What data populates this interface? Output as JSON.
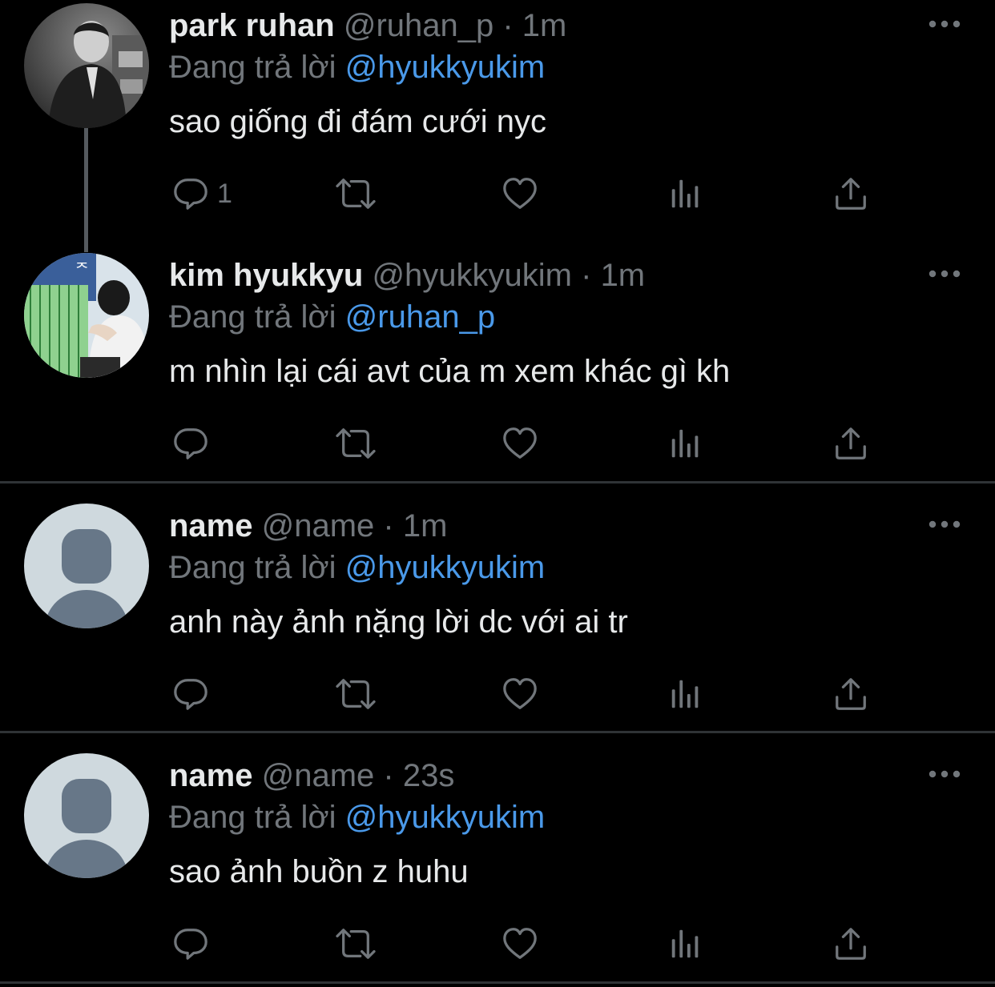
{
  "tweets": [
    {
      "name": "park ruhan",
      "handle": "@ruhan_p",
      "time": "1m",
      "reply_prefix": "Đang trả lời",
      "reply_to": "@hyukkyukim",
      "text": "sao giống đi đám cưới nyc",
      "reply_count": "1",
      "avatar": "photo-monochrome"
    },
    {
      "name": "kim hyukkyu",
      "handle": "@hyukkyukim",
      "time": "1m",
      "reply_prefix": "Đang trả lời",
      "reply_to": "@ruhan_p",
      "text": "m nhìn lại cái avt của m xem khác gì kh",
      "reply_count": "",
      "avatar": "photo-color"
    },
    {
      "name": "name",
      "handle": "@name",
      "time": "1m",
      "reply_prefix": "Đang trả lời",
      "reply_to": "@hyukkyukim",
      "text": "anh này ảnh nặng lời dc với ai tr",
      "reply_count": "",
      "avatar": "default-avatar"
    },
    {
      "name": "name",
      "handle": "@name",
      "time": "23s",
      "reply_prefix": "Đang trả lời",
      "reply_to": "@hyukkyukim",
      "text": "sao ảnh buồn z huhu",
      "reply_count": "",
      "avatar": "default-avatar"
    }
  ],
  "separator": " · ",
  "icons": [
    "reply-icon",
    "retweet-icon",
    "like-icon",
    "views-icon",
    "share-icon",
    "more-icon"
  ],
  "colors": {
    "background": "#000000",
    "text": "#e7e9ea",
    "muted": "#71767b",
    "link": "#4a99e9",
    "divider": "#2f3336"
  }
}
